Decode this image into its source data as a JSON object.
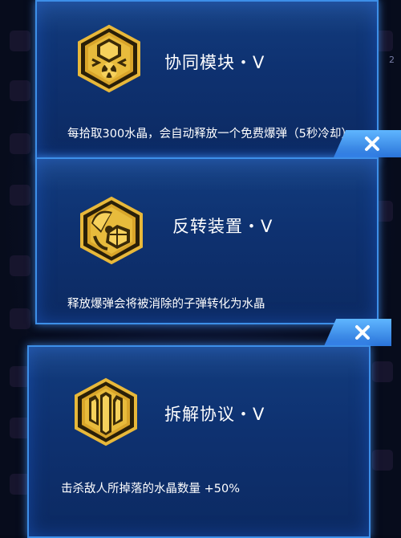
{
  "cards": [
    {
      "title": "协同模块・V",
      "desc": "每拾取300水晶，会自动释放一个免费爆弹（5秒冷却）",
      "icon": "crystal-bomb-icon"
    },
    {
      "title": "反转装置・V",
      "desc": "释放爆弹会将被消除的子弹转化为水晶",
      "icon": "radiation-crystal-icon"
    },
    {
      "title": "拆解协议・V",
      "desc": "击杀敌人所掉落的水晶数量 +50%",
      "icon": "crystal-stack-icon"
    }
  ],
  "close_label": "close",
  "colors": {
    "card_bg": "#0e3170",
    "border": "#3d8fe8",
    "badge_gold": "#e8b83a",
    "close_bg": "#4a9eff"
  },
  "side_numbers": {
    "right_top": "2"
  }
}
